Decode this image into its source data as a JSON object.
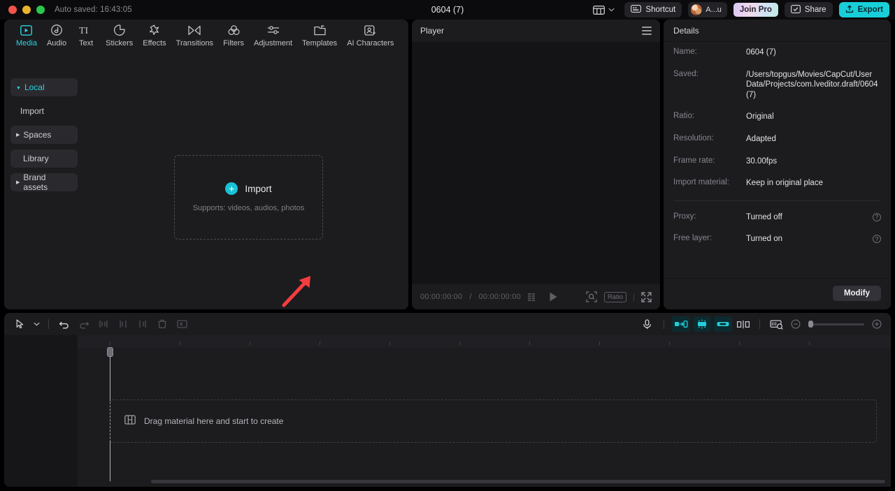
{
  "window": {
    "autosave_label": "Auto saved: 16:43:05",
    "project_title": "0604 (7)"
  },
  "topbar": {
    "layout_icon": "layout-grid-icon",
    "shortcut_label": "Shortcut",
    "account_name": "A...u",
    "join_pro_label": "Join Pro",
    "share_label": "Share",
    "export_label": "Export",
    "accent_color": "#18cfd9"
  },
  "tabs": [
    {
      "label": "Media",
      "icon": "media-icon",
      "active": true
    },
    {
      "label": "Audio",
      "icon": "audio-note-icon",
      "active": false
    },
    {
      "label": "Text",
      "icon": "text-ti-icon",
      "active": false
    },
    {
      "label": "Stickers",
      "icon": "sticker-icon",
      "active": false
    },
    {
      "label": "Effects",
      "icon": "effects-sparkle-icon",
      "active": false
    },
    {
      "label": "Transitions",
      "icon": "transitions-icon",
      "active": false
    },
    {
      "label": "Filters",
      "icon": "filters-circles-icon",
      "active": false
    },
    {
      "label": "Adjustment",
      "icon": "adjustment-sliders-icon",
      "active": false
    },
    {
      "label": "Templates",
      "icon": "templates-icon",
      "active": false
    },
    {
      "label": "AI Characters",
      "icon": "ai-characters-icon",
      "active": false
    }
  ],
  "sidebar": {
    "items": [
      {
        "label": "Local",
        "expandable": true,
        "expanded": true,
        "active": true
      },
      {
        "label": "Import",
        "expandable": false,
        "expanded": false,
        "active": false
      },
      {
        "label": "Spaces",
        "expandable": true,
        "expanded": false,
        "active": false
      },
      {
        "label": "Library",
        "expandable": false,
        "expanded": false,
        "active": false
      },
      {
        "label": "Brand assets",
        "expandable": true,
        "expanded": false,
        "active": false
      }
    ]
  },
  "media": {
    "import_label": "Import",
    "supports_label": "Supports: videos, audios, photos",
    "plus_icon": "plus-circle-icon",
    "annotation_arrow": "red-arrow-annotation"
  },
  "player": {
    "title": "Player",
    "menu_icon": "hamburger-menu-icon",
    "current_time": "00:00:00:00",
    "time_separator": "/",
    "total_time": "00:00:00:00",
    "list_icon": "playlist-icon",
    "play_icon": "play-icon",
    "zoom_icon": "magnifier-frame-icon",
    "ratio_label": "Ratio",
    "fullscreen_icon": "fullscreen-icon"
  },
  "details": {
    "title": "Details",
    "rows": [
      {
        "key": "Name:",
        "value": "0604 (7)"
      },
      {
        "key": "Saved:",
        "value": "/Users/topgus/Movies/CapCut/User Data/Projects/com.lveditor.draft/0604 (7)"
      },
      {
        "key": "Ratio:",
        "value": "Original"
      },
      {
        "key": "Resolution:",
        "value": "Adapted"
      },
      {
        "key": "Frame rate:",
        "value": "30.00fps"
      },
      {
        "key": "Import material:",
        "value": "Keep in original place"
      }
    ],
    "toggles": [
      {
        "key": "Proxy:",
        "value": "Turned off",
        "help_icon": "help-circle-icon"
      },
      {
        "key": "Free layer:",
        "value": "Turned on",
        "help_icon": "help-circle-icon"
      }
    ],
    "modify_label": "Modify"
  },
  "timeline": {
    "tools_left": [
      {
        "name": "select-pointer-tool",
        "icon": "cursor-arrow-icon"
      },
      {
        "name": "select-dropdown",
        "icon": "chevron-down-icon"
      },
      {
        "name": "undo-button",
        "icon": "undo-icon"
      },
      {
        "name": "redo-button",
        "icon": "redo-icon"
      },
      {
        "name": "split-button",
        "icon": "split-icon"
      },
      {
        "name": "trim-left-button",
        "icon": "trim-left-icon"
      },
      {
        "name": "trim-right-button",
        "icon": "trim-right-icon"
      },
      {
        "name": "delete-button",
        "icon": "trash-icon"
      },
      {
        "name": "crop-button",
        "icon": "crop-icon"
      }
    ],
    "tools_right": [
      {
        "name": "record-voiceover-button",
        "icon": "microphone-icon",
        "highlighted": false
      },
      {
        "name": "keyframe-in-button",
        "icon": "clip-in-icon",
        "highlighted": true
      },
      {
        "name": "auto-cut-button",
        "icon": "auto-cut-icon",
        "highlighted": true
      },
      {
        "name": "clip-link-button",
        "icon": "clip-link-icon",
        "highlighted": true
      },
      {
        "name": "mirror-button",
        "icon": "mirror-icon",
        "highlighted": false
      },
      {
        "name": "preview-render-button",
        "icon": "preview-render-icon",
        "highlighted": false
      }
    ],
    "zoom_out_icon": "zoom-out-icon",
    "zoom_in_icon": "zoom-in-icon",
    "zoom_value": 0,
    "drop_hint": "Drag material here and start to create",
    "drop_icon": "film-strip-icon",
    "playhead_position": "00:00:00:00"
  }
}
